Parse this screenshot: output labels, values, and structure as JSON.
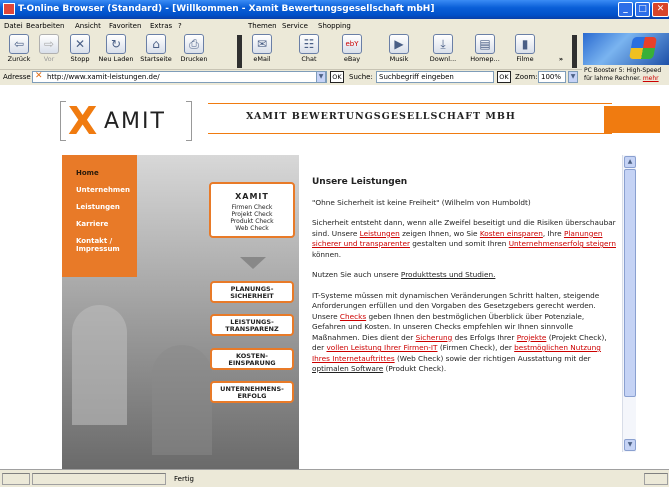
{
  "window": {
    "title": "T-Online Browser (Standard) - [Willkommen - Xamit Bewertungsgesellschaft mbH]",
    "controls": [
      "_",
      "□",
      "✕"
    ]
  },
  "menu": {
    "items": [
      "Datei",
      "Bearbeiten",
      "Ansicht",
      "Favoriten",
      "Extras",
      "?"
    ],
    "items_right": [
      "Themen",
      "Service",
      "Shopping"
    ]
  },
  "toolbar": {
    "back": "Zurück",
    "forward": "Vor",
    "stop": "Stopp",
    "reload": "Neu Laden",
    "home": "Startseite",
    "print": "Drucken",
    "email": "eMail",
    "chat": "Chat",
    "ebay": "eBay",
    "ebay_logo": "ebY",
    "musik": "Musik",
    "download": "Downl...",
    "homepage": "Homep...",
    "filme": "Filme",
    "more": "»"
  },
  "ad": {
    "line1": "PC Booster 5: High-Speed",
    "line2": "für lahme Rechner.",
    "link": "mehr"
  },
  "addressbar": {
    "label": "Adresse",
    "url": "http://www.xamit-leistungen.de/",
    "ok": "OK",
    "search_label": "Suche:",
    "search_placeholder": "Suchbegriff eingeben",
    "zoom_label": "Zoom:",
    "zoom_value": "100%"
  },
  "page": {
    "logo_x": "X",
    "logo_text": "AMIT",
    "header_title": "XAMIT BEWERTUNGSGESELLSCHAFT MBH",
    "nav": [
      "Home",
      "Unternehmen",
      "Leistungen",
      "Karriere",
      "Kontakt /",
      "Impressum"
    ],
    "check_box": {
      "title": "XAMIT",
      "items": [
        "Firmen Check",
        "Projekt Check",
        "Produkt Check",
        "Web Check"
      ]
    },
    "buttons": [
      [
        "PLANUNGS-",
        "SICHERHEIT"
      ],
      [
        "LEISTUNGS-",
        "TRANSPARENZ"
      ],
      [
        "KOSTEN-",
        "EINSPARUNG"
      ],
      [
        "UNTERNEHMENS-",
        "ERFOLG"
      ]
    ],
    "heading": "Unsere Leistungen",
    "quote": "\"Ohne Sicherheit ist keine Freiheit\" (Wilhelm von Humboldt)",
    "p1_a": "Sicherheit entsteht dann, wenn alle Zweifel beseitigt und die Risiken überschaubar sind. Unsere ",
    "p1_link1": "Leistungen",
    "p1_b": " zeigen Ihnen, wo Sie ",
    "p1_link2": "Kosten einsparen",
    "p1_c": ", Ihre ",
    "p1_link3": "Planungen sicherer und transparenter",
    "p1_d": " gestalten und somit Ihren ",
    "p1_link4": "Unternehmenserfolg steigern",
    "p1_e": " können.",
    "p2_a": "Nutzen Sie auch unsere ",
    "p2_link": "Produkttests und Studien.",
    "p3": "IT-Systeme müssen mit dynamischen Veränderungen Schritt halten, steigende Anforderungen erfüllen und den Vorgaben des Gesetzgebers gerecht werden.",
    "p4_a": "Unsere ",
    "p4_link1": "Checks",
    "p4_b": " geben Ihnen den bestmöglichen Überblick über Potenziale, Gefahren und Kosten. In unseren Checks empfehlen wir Ihnen sinnvolle Maßnahmen. Dies dient der ",
    "p4_link2": "Sicherung",
    "p4_c": " des Erfolgs Ihrer ",
    "p4_link3": "Projekte",
    "p4_d": " (Projekt Check), der ",
    "p4_link4": "vollen Leistung Ihrer Firmen-IT",
    "p4_e": " (Firmen Check), der ",
    "p4_link5": "bestmöglichen Nutzung Ihres Internetauftrittes",
    "p4_f": " (Web Check) sowie der richtigen Ausstattung mit der ",
    "p4_link6": "optimalen Software",
    "p4_g": " (Produkt Check)."
  },
  "status": {
    "text": "Fertig"
  }
}
